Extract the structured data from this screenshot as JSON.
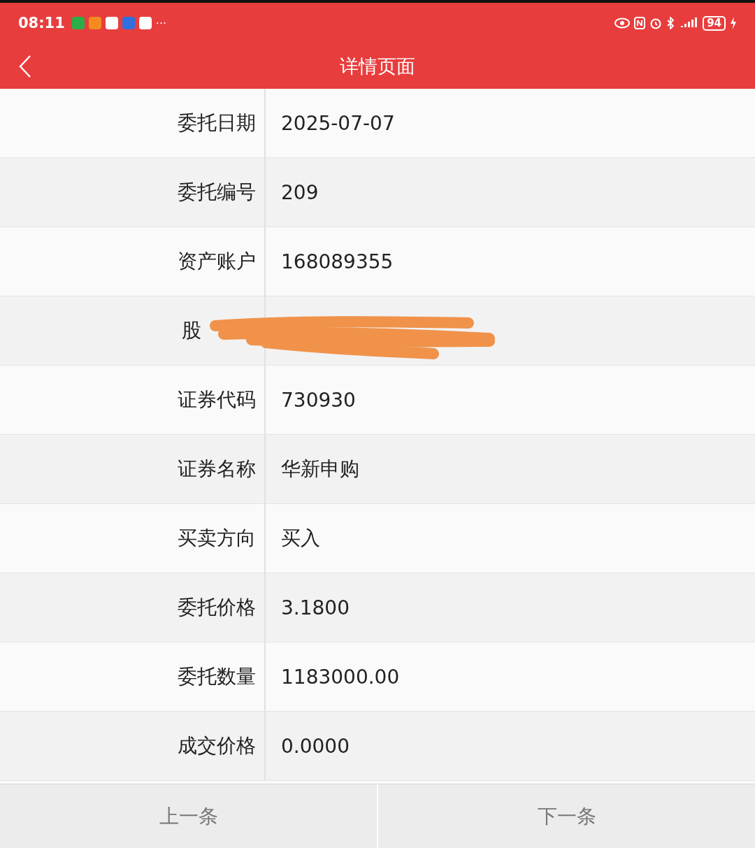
{
  "status_bar": {
    "time": "08:11",
    "more": "···",
    "battery": "94"
  },
  "header": {
    "title": "详情页面"
  },
  "rows": [
    {
      "kind": "field",
      "label": "委托日期",
      "value": "2025-07-07"
    },
    {
      "kind": "field",
      "label": "委托编号",
      "value": "209"
    },
    {
      "kind": "field",
      "label": "资产账户",
      "value": "168089355"
    },
    {
      "kind": "redacted",
      "label": "股"
    },
    {
      "kind": "field",
      "label": "证券代码",
      "value": "730930"
    },
    {
      "kind": "field",
      "label": "证券名称",
      "value": "华新申购"
    },
    {
      "kind": "field",
      "label": "买卖方向",
      "value": "买入"
    },
    {
      "kind": "field",
      "label": "委托价格",
      "value": "3.1800"
    },
    {
      "kind": "field",
      "label": "委托数量",
      "value": "1183000.00"
    },
    {
      "kind": "field",
      "label": "成交价格",
      "value": "0.0000"
    }
  ],
  "footer": {
    "buttons": [
      "上一条",
      "下一条"
    ]
  }
}
